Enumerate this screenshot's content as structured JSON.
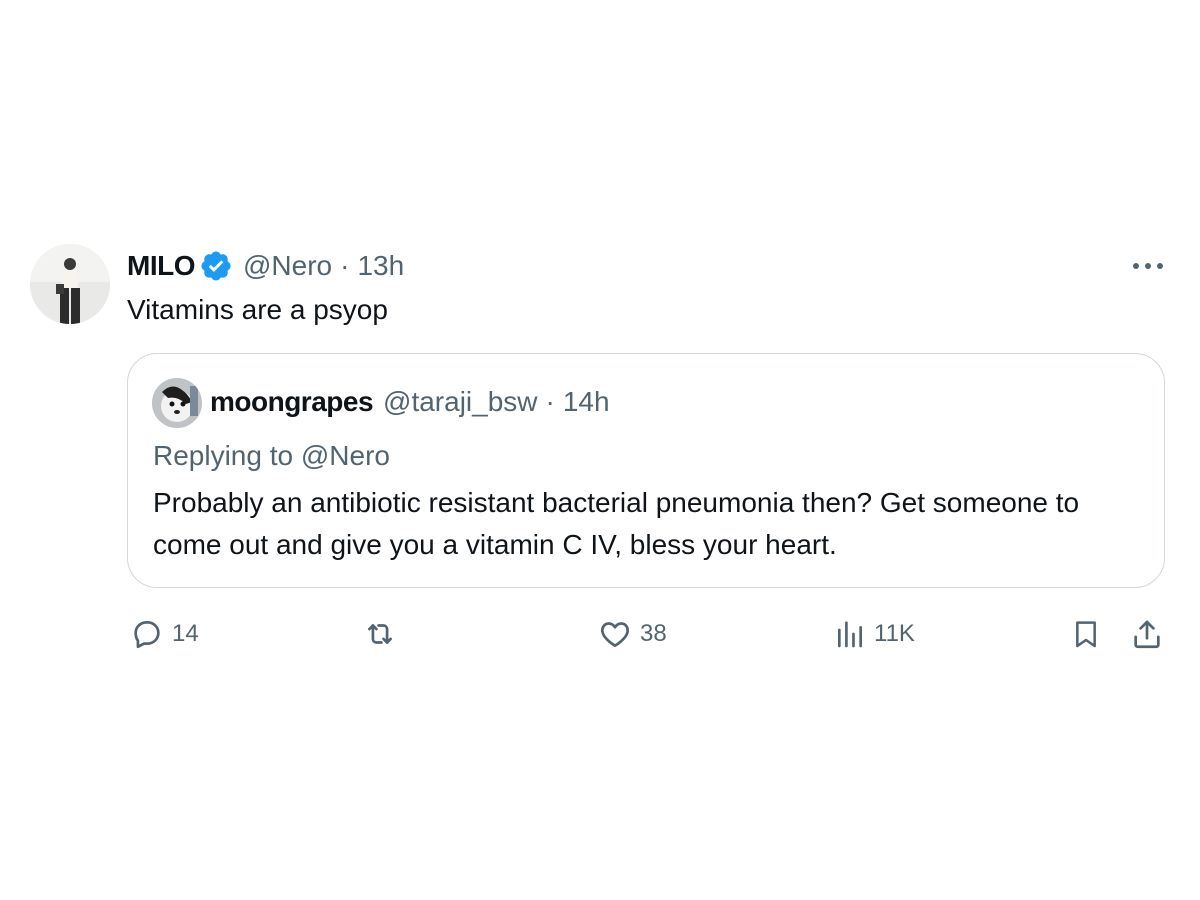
{
  "tweet": {
    "display_name": "MILO",
    "handle": "@Nero",
    "separator": "·",
    "time": "13h",
    "text": "Vitamins are a psyop",
    "verified_icon": "verified-badge-icon",
    "more_icon": "more-options-icon"
  },
  "quote": {
    "display_name": "moongrapes",
    "handle": "@taraji_bsw",
    "separator": "·",
    "time": "14h",
    "replying_to": "Replying to @Nero",
    "text": "Probably an antibiotic resistant bacterial pneumonia then? Get someone to come out and give you a vitamin C IV, bless your heart."
  },
  "actions": {
    "reply_count": "14",
    "retweet_count": "",
    "like_count": "38",
    "views_count": "11K",
    "icons": [
      "reply-icon",
      "retweet-icon",
      "like-icon",
      "views-icon",
      "bookmark-icon",
      "share-icon"
    ]
  },
  "colors": {
    "text_primary": "#0f1419",
    "text_secondary": "#536471",
    "verified_blue": "#1d9bf0",
    "border": "#cfd9de"
  }
}
